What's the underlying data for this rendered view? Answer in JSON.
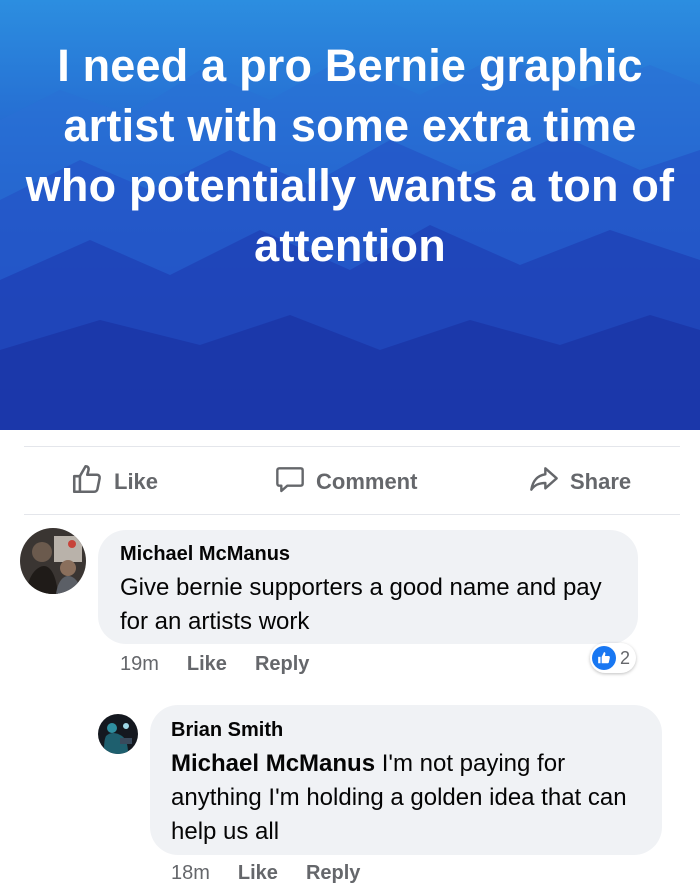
{
  "post": {
    "banner_text": "I need a pro Bernie graphic artist with some extra time who potentially wants a ton of attention"
  },
  "actions": {
    "like_label": "Like",
    "comment_label": "Comment",
    "share_label": "Share"
  },
  "comments": [
    {
      "author": "Michael McManus",
      "text": "Give bernie supporters a good name and pay for an artists work",
      "time": "19m",
      "like_label": "Like",
      "reply_label": "Reply",
      "reaction_count": "2"
    },
    {
      "author": "Brian Smith",
      "mention": "Michael McManus",
      "text": " I'm not paying for anything I'm holding a golden idea that can help us all",
      "time": "18m",
      "like_label": "Like",
      "reply_label": "Reply"
    }
  ],
  "colors": {
    "brand_blue": "#1877f2",
    "secondary_text": "#65676b",
    "bubble_bg": "#f0f2f5"
  },
  "icons": [
    "thumbs-up-icon",
    "comment-icon",
    "share-arrow-icon",
    "like-reaction-icon"
  ]
}
